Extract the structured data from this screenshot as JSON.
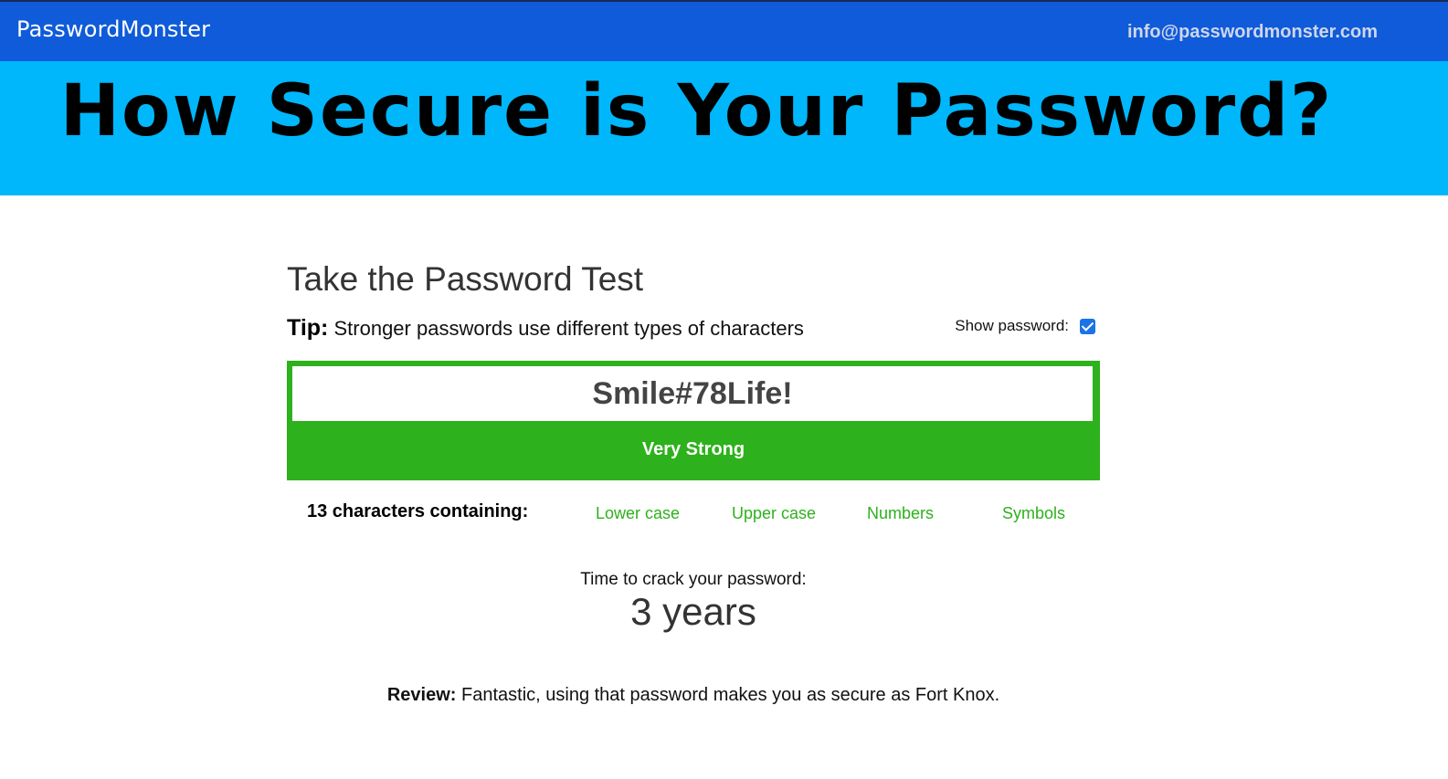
{
  "header": {
    "brand": "PasswordMonster",
    "email": "info@passwordmonster.com"
  },
  "banner": {
    "title": "How Secure is Your Password?"
  },
  "main": {
    "title": "Take the Password Test",
    "tip_label": "Tip:",
    "tip_text": " Stronger passwords use different types of characters",
    "show_password_label": "Show password:",
    "show_password_checked": true,
    "password_value": "Smile#78Life!",
    "strength": "Very Strong",
    "chars_label": "13 characters containing:",
    "char_types": [
      "Lower case",
      "Upper case",
      "Numbers",
      "Symbols"
    ],
    "crack_label": "Time to crack your password:",
    "crack_value": "3 years",
    "review_label": "Review:",
    "review_text": " Fantastic, using that password makes you as secure as Fort Knox."
  },
  "colors": {
    "topbar": "#0f5bd9",
    "banner": "#00b7fb",
    "strength_green": "#2db11c"
  }
}
